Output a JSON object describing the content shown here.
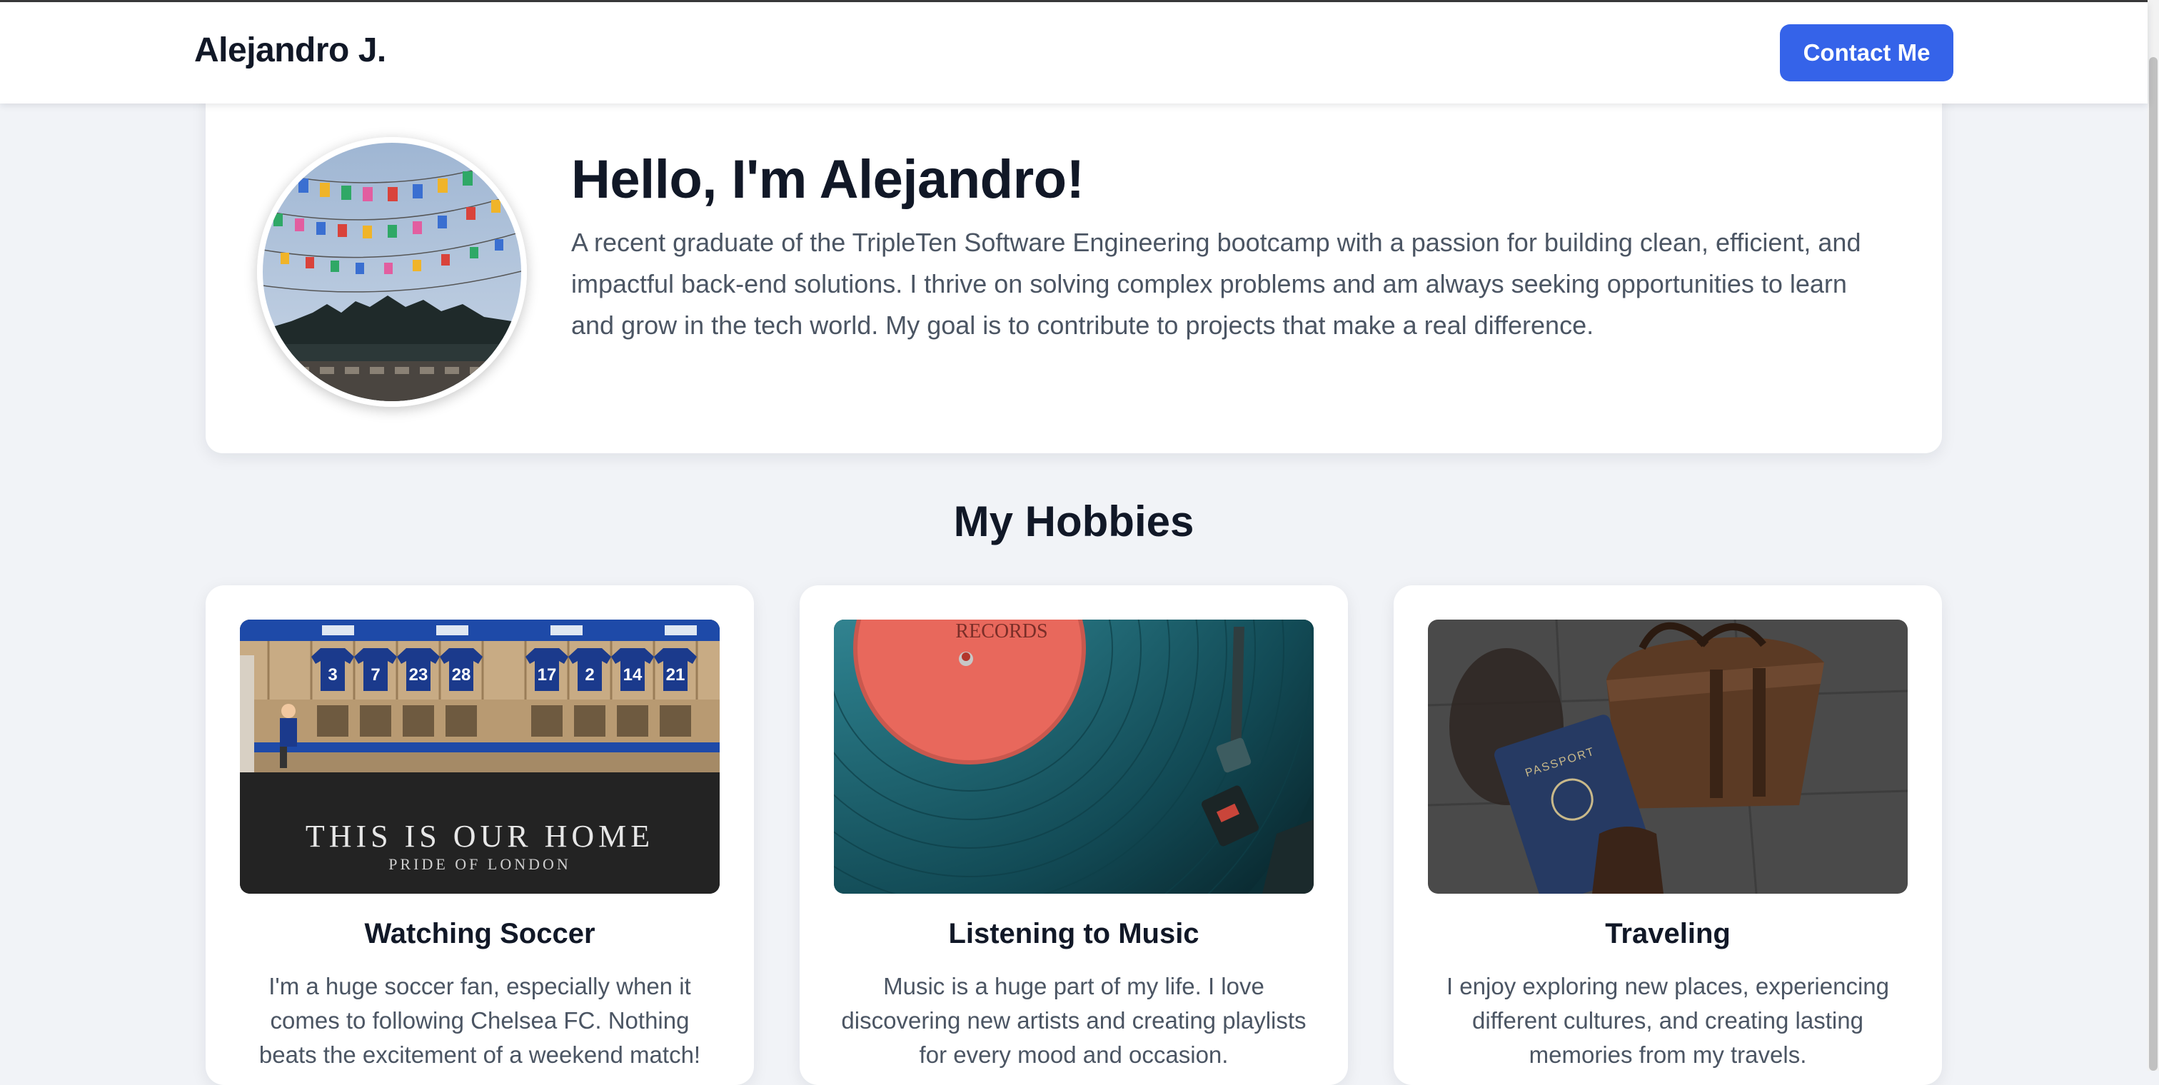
{
  "header": {
    "brand": "Alejandro J.",
    "contact_label": "Contact Me"
  },
  "intro": {
    "greeting": "Hello, I'm Alejandro!",
    "bio": "A recent graduate of the TripleTen Software Engineering bootcamp with a passion for building clean, efficient, and impactful back-end solutions. I thrive on solving complex problems and am always seeking opportunities to learn and grow in the tech world. My goal is to contribute to projects that make a real difference."
  },
  "hobbies": {
    "title": "My Hobbies",
    "items": [
      {
        "title": "Watching Soccer",
        "description": "I'm a huge soccer fan, especially when it comes to following Chelsea FC. Nothing beats the excitement of a weekend match!",
        "image_text": {
          "jersey_numbers": [
            "3",
            "7",
            "23",
            "28",
            "17",
            "2",
            "14",
            "21"
          ],
          "floor_line1": "THIS IS OUR HOME",
          "floor_line2": "PRIDE OF LONDON"
        }
      },
      {
        "title": "Listening to Music",
        "description": "Music is a huge part of my life. I love discovering new artists and creating playlists for every mood and occasion.",
        "image_text": {
          "label_text": "RECORDS"
        }
      },
      {
        "title": "Traveling",
        "description": "I enjoy exploring new places, experiencing different cultures, and creating lasting memories from my travels.",
        "image_text": {
          "passport_text": "PASSPORT"
        }
      }
    ]
  },
  "colors": {
    "accent": "#3563e9",
    "page_bg": "#f1f3f7",
    "card_bg": "#ffffff",
    "heading": "#111827",
    "body_text": "#4b5563"
  },
  "icons": {
    "avatar": "profile-photo",
    "hobby_images": [
      "locker-room-photo",
      "vinyl-record-photo",
      "luggage-passport-photo"
    ]
  }
}
